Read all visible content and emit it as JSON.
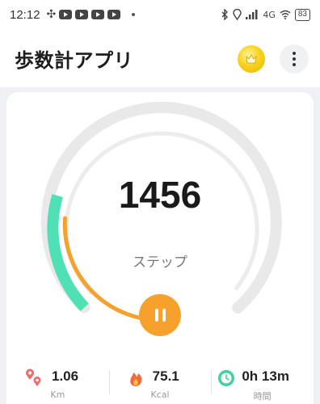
{
  "status_bar": {
    "time": "12:12",
    "network": "4G",
    "battery": "83",
    "icons": [
      "slack-icon",
      "youtube-icon",
      "youtube-icon",
      "youtube-icon",
      "youtube-icon",
      "notification-dot-icon",
      "bluetooth-icon",
      "location-icon",
      "signal-icon",
      "wifi-icon",
      "battery-icon"
    ]
  },
  "header": {
    "title": "歩数計アプリ"
  },
  "tracker": {
    "steps": "1456",
    "steps_label": "ステップ",
    "colors": {
      "progress_teal": "#4fe0b6",
      "progress_orange": "#f5a12c",
      "track_gray": "#e9e9e9"
    }
  },
  "stats": {
    "distance": {
      "value": "1.06",
      "unit": "Km"
    },
    "calories": {
      "value": "75.1",
      "unit": "Kcal"
    },
    "time": {
      "value": "0h 13m",
      "unit": "時間"
    }
  }
}
